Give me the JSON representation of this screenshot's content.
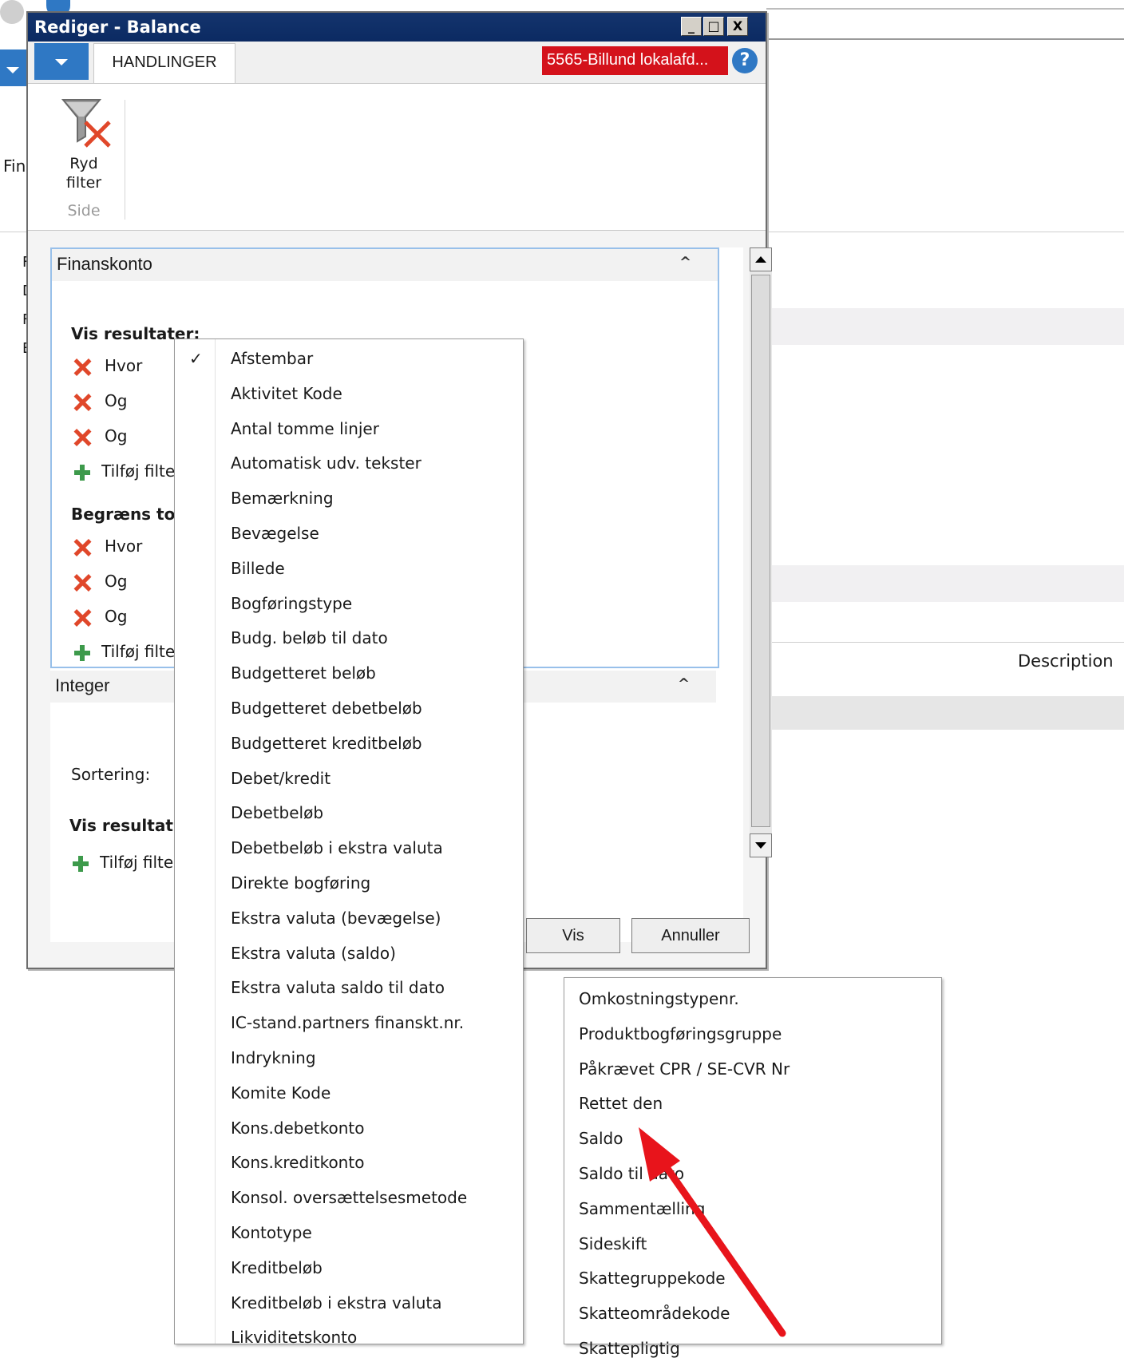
{
  "background": {
    "fin_partial": "Fin",
    "letters": [
      "F",
      "D",
      "F",
      "E"
    ],
    "description_header": "Description"
  },
  "dialog": {
    "title": "Rediger - Balance",
    "window_buttons": [
      "_",
      "□",
      "X"
    ],
    "ribbon": {
      "tab": "HANDLINGER",
      "company": "5565-Billund lokalafd...",
      "help": "?",
      "clear_filter_label_1": "Ryd",
      "clear_filter_label_2": "filter",
      "group_label": "Side"
    },
    "finanskonto": {
      "header": "Finanskonto",
      "vis_resultater": "Vis resultater:",
      "result_rows": [
        "Hvor",
        "Og",
        "Og"
      ],
      "add_filter_1": "Tilføj filter",
      "begraens": "Begræns to",
      "limit_rows": [
        "Hvor",
        "Og",
        "Og"
      ],
      "add_filter_2": "Tilføj filter"
    },
    "integer": {
      "header": "Integer",
      "sortering": "Sortering:",
      "vis_resultater": "Vis resultat",
      "add_filter": "Tilføj filter"
    },
    "buttons": {
      "ok": "Vis",
      "cancel": "Annuller"
    }
  },
  "field_menu": {
    "checked": "✓",
    "items": [
      "Afstembar",
      "Aktivitet Kode",
      "Antal tomme linjer",
      "Automatisk udv. tekster",
      "Bemærkning",
      "Bevægelse",
      "Billede",
      "Bogføringstype",
      "Budg. beløb til dato",
      "Budgetteret beløb",
      "Budgetteret debetbeløb",
      "Budgetteret kreditbeløb",
      "Debet/kredit",
      "Debetbeløb",
      "Debetbeløb i ekstra valuta",
      "Direkte bogføring",
      "Ekstra valuta (bevægelse)",
      "Ekstra valuta (saldo)",
      "Ekstra valuta saldo til dato",
      "IC-stand.partners finanskt.nr.",
      "Indrykning",
      "Komite Kode",
      "Kons.debetkonto",
      "Kons.kreditkonto",
      "Konsol. oversættelsesmetode",
      "Kontotype",
      "Kreditbeløb",
      "Kreditbeløb i ekstra valuta",
      "Likviditetskonto"
    ]
  },
  "field_menu_2": {
    "items": [
      "Omkostningstypenr.",
      "Produktbogføringsgruppe",
      "Påkrævet CPR / SE-CVR Nr",
      "Rettet den",
      "Saldo",
      "Saldo til dato",
      "Sammentælling",
      "Sideskift",
      "Skattegruppekode",
      "Skatteområdekode",
      "Skattepligtig"
    ]
  },
  "annotation": {
    "arrow_color": "#e8141b"
  }
}
